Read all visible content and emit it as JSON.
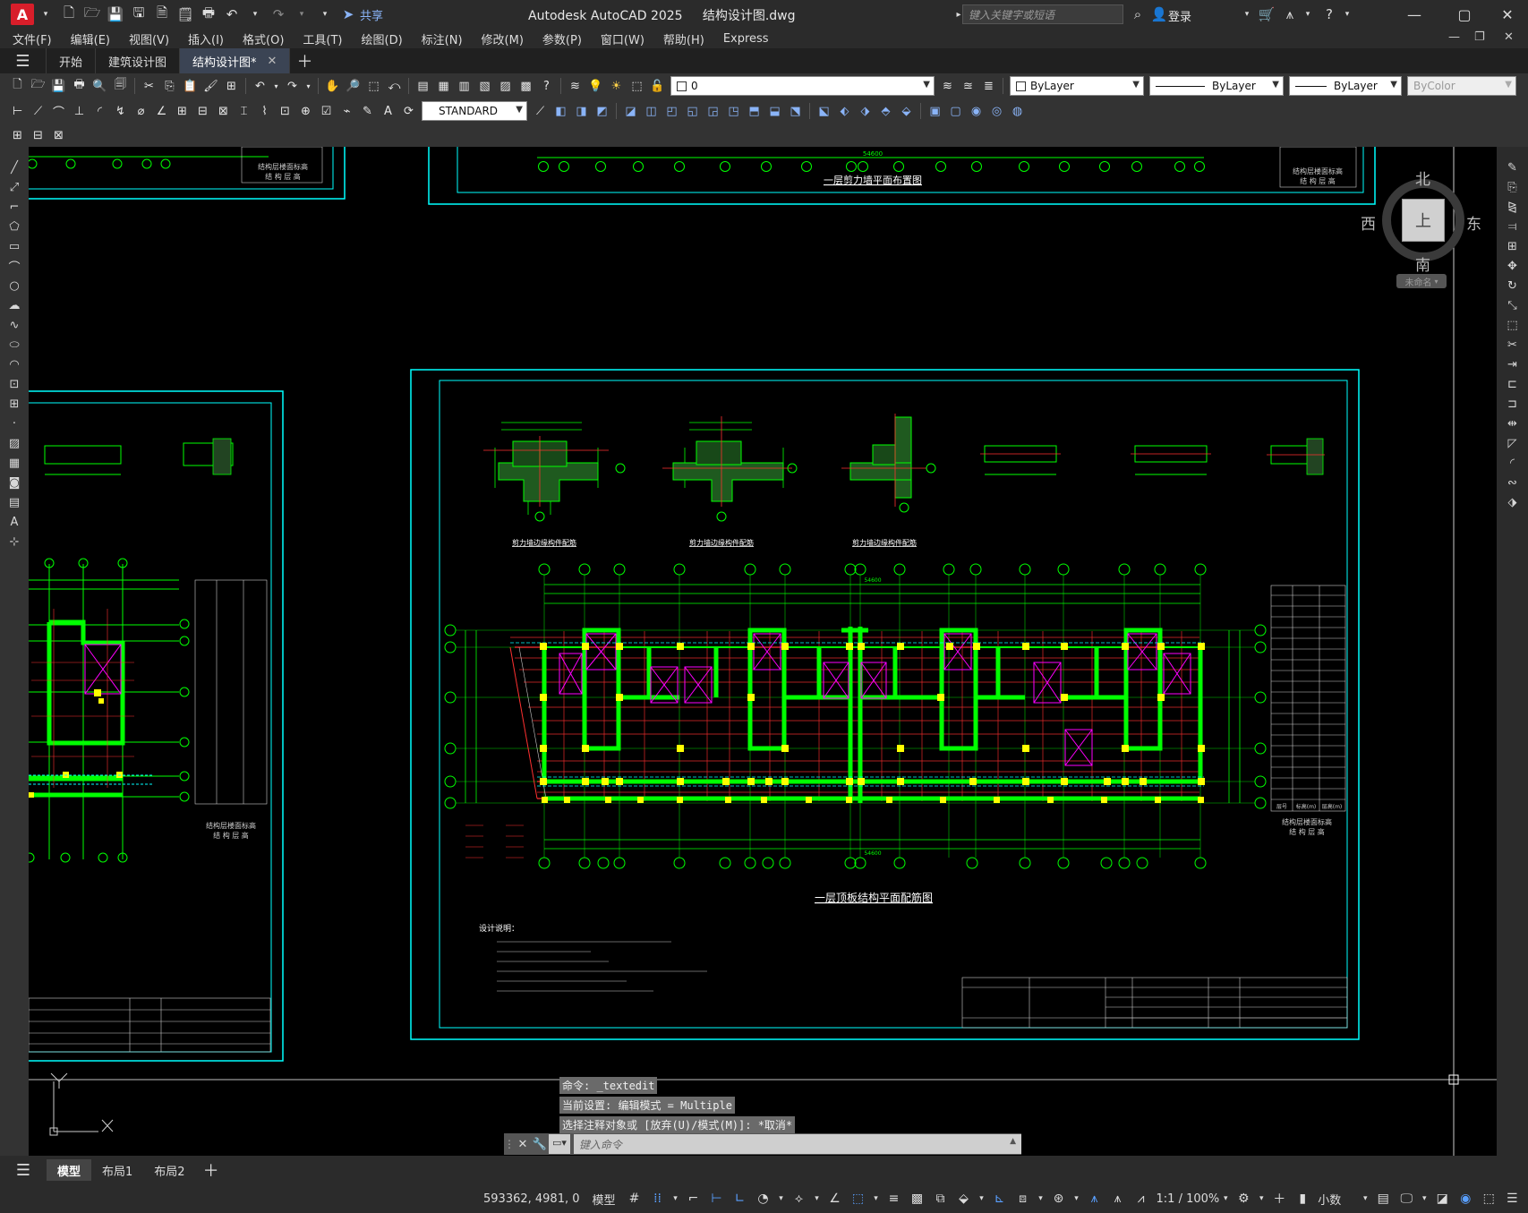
{
  "titlebar": {
    "app_title": "Autodesk AutoCAD 2025",
    "file_name": "结构设计图.dwg",
    "share_label": "共享",
    "search_placeholder": "键入关键字或短语",
    "login_label": "登录"
  },
  "menu": [
    "文件(F)",
    "编辑(E)",
    "视图(V)",
    "插入(I)",
    "格式(O)",
    "工具(T)",
    "绘图(D)",
    "标注(N)",
    "修改(M)",
    "参数(P)",
    "窗口(W)",
    "帮助(H)",
    "Express"
  ],
  "tabs": [
    {
      "label": "开始",
      "active": false
    },
    {
      "label": "建筑设计图",
      "active": false
    },
    {
      "label": "结构设计图*",
      "active": true
    }
  ],
  "properties": {
    "layer_value": "0",
    "text_style": "STANDARD",
    "color": "ByLayer",
    "linetype": "ByLayer",
    "lineweight": "ByLayer",
    "plotstyle": "ByColor"
  },
  "viewcube": {
    "north": "北",
    "south": "南",
    "east": "东",
    "west": "西",
    "face": "上",
    "wcs_label": "未命名"
  },
  "drawing": {
    "top_title": "一层剪力墙平面布置图",
    "main_title": "一层顶板结构平面配筋图",
    "notes_heading": "设计说明：",
    "detail_titles": [
      "剪力墙边缘构件配筋",
      "剪力墙边缘构件配筋",
      "剪力墙边缘构件配筋"
    ],
    "dim_total": "54600",
    "elevation_table_header": [
      "层号",
      "标高(m)",
      "层高(m)"
    ],
    "structure_label": "结构层楼面标高",
    "structure_label2": "结 构 层 高"
  },
  "command": {
    "history": [
      "命令: _textedit",
      "当前设置: 编辑模式 = Multiple",
      "选择注释对象或 [放弃(U)/模式(M)]: *取消*"
    ],
    "placeholder": "键入命令"
  },
  "layouts": [
    {
      "label": "模型",
      "active": true
    },
    {
      "label": "布局1",
      "active": false
    },
    {
      "label": "布局2",
      "active": false
    }
  ],
  "status": {
    "coordinates": "593362, 4981, 0",
    "model_label": "模型",
    "scale": "1:1 / 100%",
    "units": "小数"
  },
  "colors": {
    "cad_green": "#00ff00",
    "cad_cyan": "#00ffff",
    "cad_yellow": "#ffff00",
    "cad_red": "#ff3030",
    "cad_magenta": "#ff00ff",
    "active_tab": "#3b4454"
  }
}
